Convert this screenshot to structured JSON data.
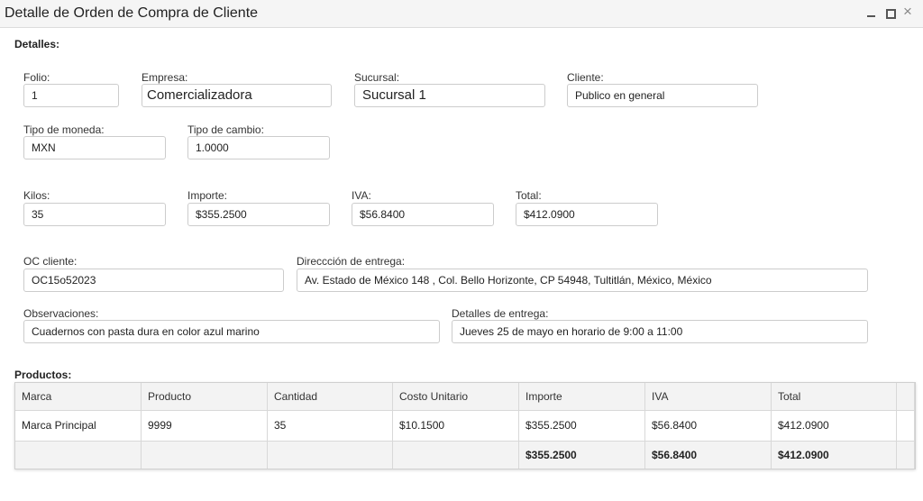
{
  "window": {
    "title": "Detalle de Orden de Compra de Cliente"
  },
  "details": {
    "section_label": "Detalles:",
    "folio": {
      "label": "Folio:",
      "value": "1"
    },
    "empresa": {
      "label": "Empresa:",
      "value": "Comercializadora"
    },
    "sucursal": {
      "label": "Sucursal:",
      "value": "Sucursal 1"
    },
    "cliente": {
      "label": "Cliente:",
      "value": "Publico en general"
    },
    "tipo_moneda": {
      "label": "Tipo de moneda:",
      "value": "MXN"
    },
    "tipo_cambio": {
      "label": "Tipo de cambio:",
      "value": "1.0000"
    },
    "kilos": {
      "label": "Kilos:",
      "value": "35"
    },
    "importe": {
      "label": "Importe:",
      "value": "$355.2500"
    },
    "iva": {
      "label": "IVA:",
      "value": "$56.8400"
    },
    "total": {
      "label": "Total:",
      "value": "$412.0900"
    },
    "oc_cliente": {
      "label": "OC cliente:",
      "value": "OC15o52023"
    },
    "direccion": {
      "label": "Direccción de entrega:",
      "value": "Av. Estado de México 148 , Col. Bello Horizonte, CP 54948, Tultitlán, México, México"
    },
    "observaciones": {
      "label": "Observaciones:",
      "value": "Cuadernos con pasta dura en color azul marino"
    },
    "detalles_entrega": {
      "label": "Detalles de entrega:",
      "value": "Jueves 25 de mayo en horario de 9:00  a 11:00"
    }
  },
  "products": {
    "section_label": "Productos:",
    "columns": [
      "Marca",
      "Producto",
      "Cantidad",
      "Costo Unitario",
      "Importe",
      "IVA",
      "Total"
    ],
    "rows": [
      [
        "Marca Principal",
        "9999",
        "35",
        "$10.1500",
        "$355.2500",
        "$56.8400",
        "$412.0900"
      ]
    ],
    "totals": [
      "",
      "",
      "",
      "",
      "$355.2500",
      "$56.8400",
      "$412.0900"
    ]
  }
}
